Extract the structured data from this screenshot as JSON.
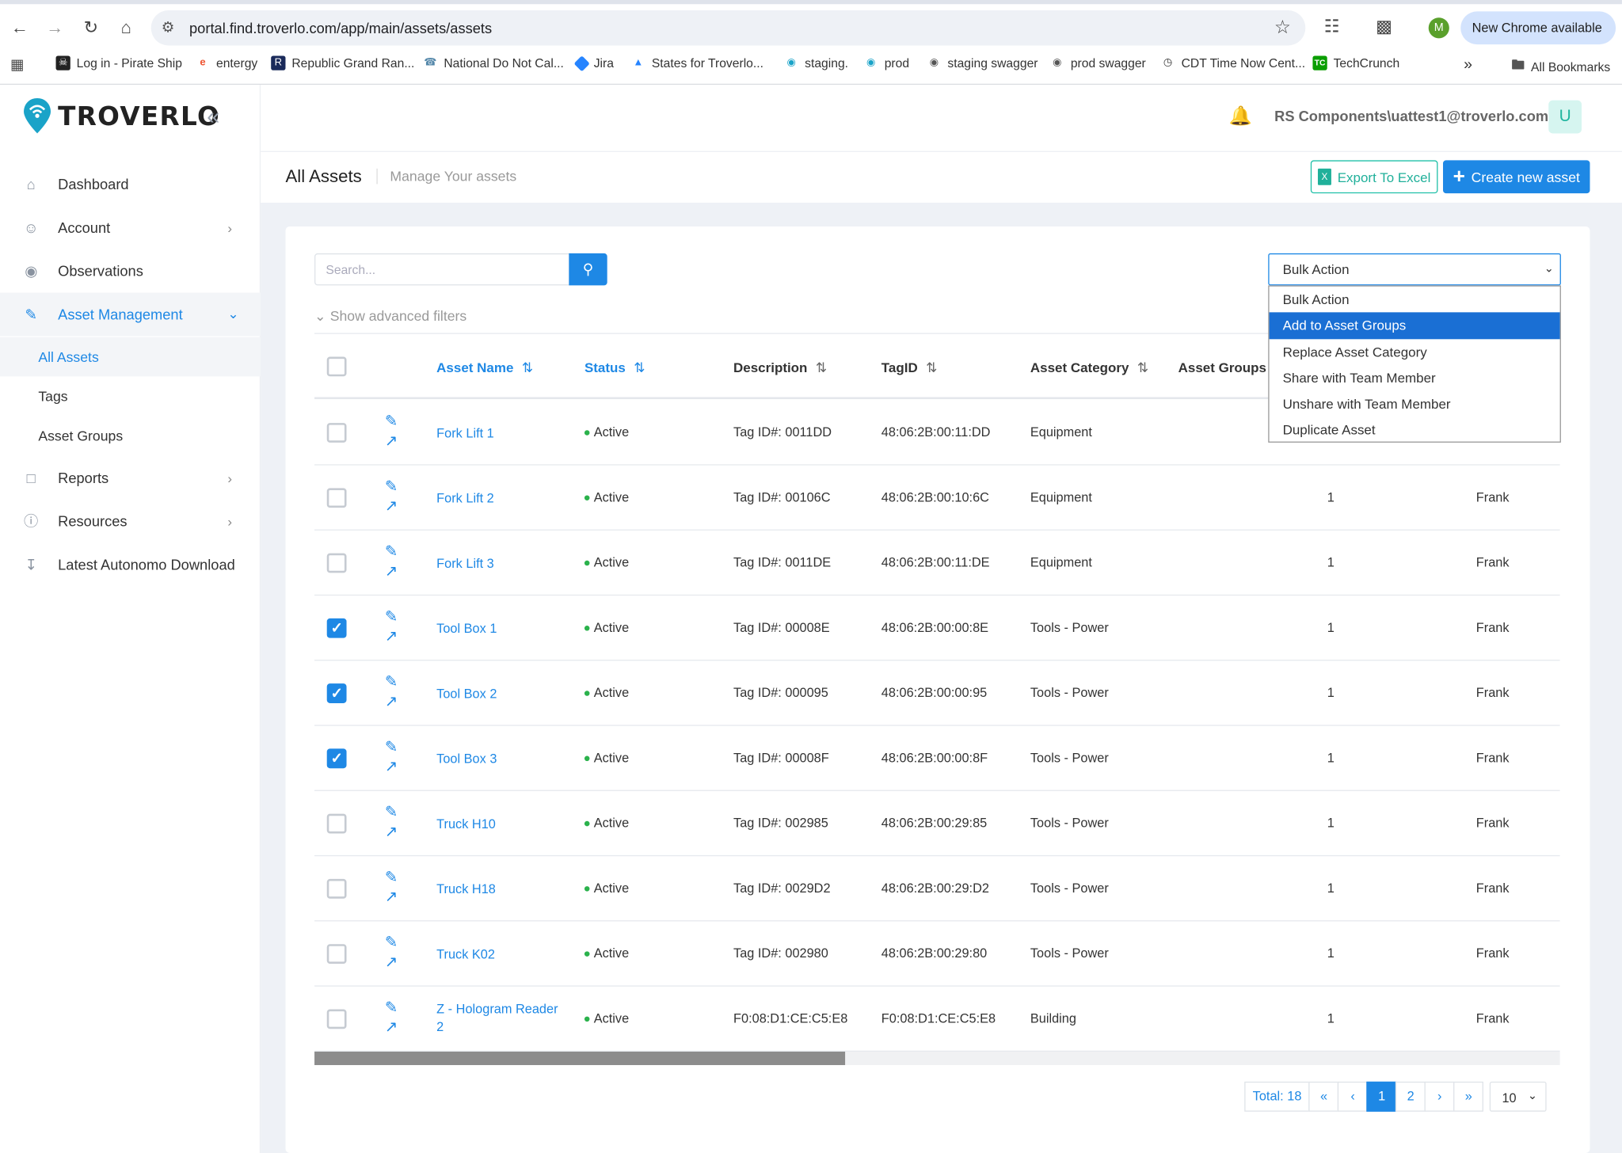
{
  "browser": {
    "url": "portal.find.troverlo.com/app/main/assets/assets",
    "new_chrome": "New Chrome available",
    "profile_initial": "M",
    "bookmarks": [
      {
        "label": "Log in - Pirate Ship",
        "icon": "pirate-ship-icon"
      },
      {
        "label": "entergy",
        "icon": "entergy-icon"
      },
      {
        "label": "Republic Grand Ran...",
        "icon": "republic-icon"
      },
      {
        "label": "National Do Not Cal...",
        "icon": "dnc-icon"
      },
      {
        "label": "Jira",
        "icon": "jira-icon"
      },
      {
        "label": "States for Troverlo...",
        "icon": "states-icon"
      },
      {
        "label": "staging.",
        "icon": "troverlo-pin-icon"
      },
      {
        "label": "prod",
        "icon": "troverlo-pin-icon"
      },
      {
        "label": "staging swagger",
        "icon": "globe-icon"
      },
      {
        "label": "prod swagger",
        "icon": "globe-icon"
      },
      {
        "label": "CDT Time Now Cent...",
        "icon": "clock-icon"
      },
      {
        "label": "TechCrunch",
        "icon": "techcrunch-icon"
      }
    ],
    "all_bookmarks": "All Bookmarks"
  },
  "sidebar": {
    "brand": "TROVERLO",
    "items": [
      {
        "label": "Dashboard",
        "icon": "home-icon"
      },
      {
        "label": "Account",
        "icon": "user-icon"
      },
      {
        "label": "Observations",
        "icon": "eye-icon"
      },
      {
        "label": "Asset Management",
        "icon": "edit-icon"
      },
      {
        "label": "Reports",
        "icon": "file-icon"
      },
      {
        "label": "Resources",
        "icon": "help-icon"
      },
      {
        "label": "Latest Autonomo Download",
        "icon": "download-icon"
      }
    ],
    "subitems": [
      "All Assets",
      "Tags",
      "Asset Groups"
    ]
  },
  "header": {
    "user": "RS Components\\uattest1@troverlo.com",
    "avatar": "U"
  },
  "page": {
    "title": "All Assets",
    "subtitle": "Manage Your assets",
    "export_label": "Export To Excel",
    "create_label": "Create new asset",
    "search_placeholder": "Search...",
    "advanced_filters": "Show advanced filters"
  },
  "bulk_action": {
    "selected": "Bulk Action",
    "options": [
      "Bulk Action",
      "Add to Asset Groups",
      "Replace Asset Category",
      "Share with Team Member",
      "Unshare with Team Member",
      "Duplicate Asset"
    ],
    "highlighted": "Add to Asset Groups"
  },
  "table": {
    "columns": [
      "Asset Name",
      "Status",
      "Description",
      "TagID",
      "Asset Category",
      "Asset Groups"
    ],
    "rows": [
      {
        "name": "Fork Lift 1",
        "status": "Active",
        "description": "Tag ID#: 0011DD",
        "tagid": "48:06:2B:00:11:DD",
        "category": "Equipment",
        "groups": "",
        "owner": "",
        "checked": false
      },
      {
        "name": "Fork Lift 2",
        "status": "Active",
        "description": "Tag ID#: 00106C",
        "tagid": "48:06:2B:00:10:6C",
        "category": "Equipment",
        "groups": "1",
        "owner": "Frank",
        "checked": false
      },
      {
        "name": "Fork Lift 3",
        "status": "Active",
        "description": "Tag ID#: 0011DE",
        "tagid": "48:06:2B:00:11:DE",
        "category": "Equipment",
        "groups": "1",
        "owner": "Frank",
        "checked": false
      },
      {
        "name": "Tool Box 1",
        "status": "Active",
        "description": "Tag ID#: 00008E",
        "tagid": "48:06:2B:00:00:8E",
        "category": "Tools - Power",
        "groups": "1",
        "owner": "Frank",
        "checked": true
      },
      {
        "name": "Tool Box 2",
        "status": "Active",
        "description": "Tag ID#: 000095",
        "tagid": "48:06:2B:00:00:95",
        "category": "Tools - Power",
        "groups": "1",
        "owner": "Frank",
        "checked": true
      },
      {
        "name": "Tool Box 3",
        "status": "Active",
        "description": "Tag ID#: 00008F",
        "tagid": "48:06:2B:00:00:8F",
        "category": "Tools - Power",
        "groups": "1",
        "owner": "Frank",
        "checked": true
      },
      {
        "name": "Truck H10",
        "status": "Active",
        "description": "Tag ID#: 002985",
        "tagid": "48:06:2B:00:29:85",
        "category": "Tools - Power",
        "groups": "1",
        "owner": "Frank",
        "checked": false
      },
      {
        "name": "Truck H18",
        "status": "Active",
        "description": "Tag ID#: 0029D2",
        "tagid": "48:06:2B:00:29:D2",
        "category": "Tools - Power",
        "groups": "1",
        "owner": "Frank",
        "checked": false
      },
      {
        "name": "Truck K02",
        "status": "Active",
        "description": "Tag ID#: 002980",
        "tagid": "48:06:2B:00:29:80",
        "category": "Tools - Power",
        "groups": "1",
        "owner": "Frank",
        "checked": false
      },
      {
        "name": "Z - Hologram Reader 2",
        "status": "Active",
        "description": "F0:08:D1:CE:C5:E8",
        "tagid": "F0:08:D1:CE:C5:E8",
        "category": "Building",
        "groups": "1",
        "owner": "Frank",
        "checked": false
      }
    ]
  },
  "pagination": {
    "total": "Total: 18",
    "pages": [
      "1",
      "2"
    ],
    "current": "1",
    "page_size": "10"
  },
  "colors": {
    "accent": "#1e88e5",
    "active": "#2bb24c",
    "teal": "#20b09a"
  }
}
